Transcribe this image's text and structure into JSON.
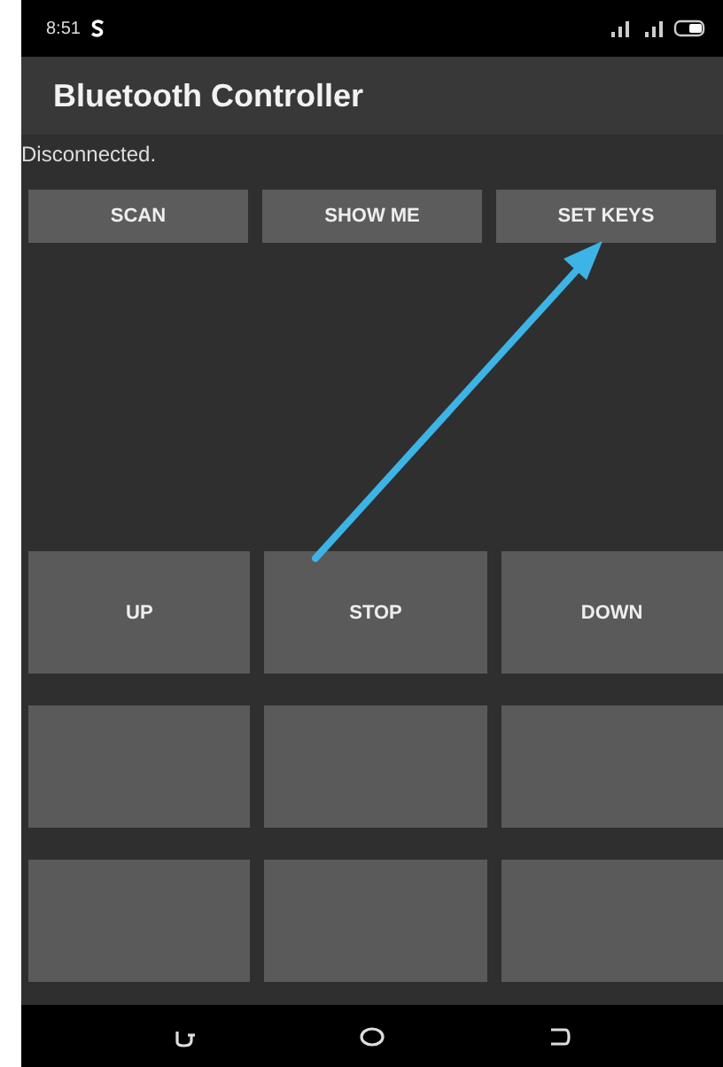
{
  "status_bar": {
    "time": "8:51"
  },
  "app_bar": {
    "title": "Bluetooth Controller"
  },
  "connection_status": "Disconnected.",
  "top_buttons": [
    "SCAN",
    "SHOW ME",
    "SET KEYS"
  ],
  "pads": [
    {
      "kind": "labeled",
      "label": "UP"
    },
    {
      "kind": "labeled",
      "label": "STOP"
    },
    {
      "kind": "labeled",
      "label": "DOWN"
    },
    {
      "kind": "blank"
    },
    {
      "kind": "blank"
    },
    {
      "kind": "blank"
    },
    {
      "kind": "blank"
    },
    {
      "kind": "blank"
    },
    {
      "kind": "blank"
    }
  ]
}
